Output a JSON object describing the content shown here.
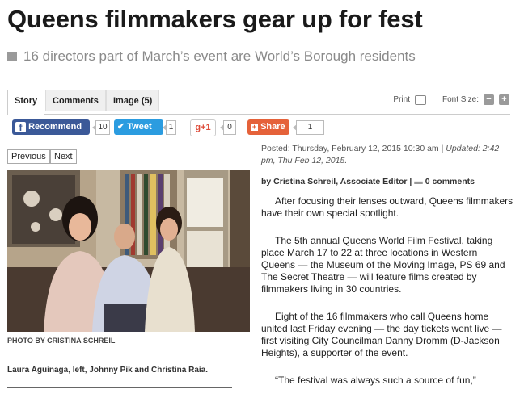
{
  "headline": "Queens filmmakers gear up for fest",
  "subhead": "16 directors part of March’s event are World’s Borough residents",
  "tabs": [
    {
      "label": "Story"
    },
    {
      "label": "Comments"
    },
    {
      "label": "Image (5)"
    }
  ],
  "tools": {
    "print": "Print",
    "font_size": "Font Size:",
    "minus": "−",
    "plus": "+"
  },
  "social": {
    "facebook": {
      "label": "Recommend",
      "count": "10"
    },
    "twitter": {
      "label": "Tweet",
      "count": "1"
    },
    "gplus": {
      "label": "g+1",
      "count": "0"
    },
    "share": {
      "label": "Share",
      "count": "1"
    }
  },
  "gallery": {
    "prev": "Previous",
    "next": "Next",
    "credit": "PHOTO BY CRISTINA SCHREIL",
    "caption": "Laura Aguinaga, left, Johnny Pik and Christina Raia."
  },
  "meta": {
    "posted": "Posted: Thursday, February 12, 2015 10:30 am |",
    "updated": "Updated: 2:42 pm, Thu Feb 12, 2015.",
    "byline": "by Cristina Schreil, Associate Editor |",
    "comments": "0 comments"
  },
  "article": {
    "p1": "After focusing their lenses outward, Queens filmmakers have their own special spotlight.",
    "p2": "The 5th annual Queens World Film Festival, taking place March 17 to 22 at three locations in Western Queens — the Museum of the Moving Image, PS 69 and The Secret Theatre — will feature films created by filmmakers living in 30 countries.",
    "p3": "Eight of the 16 filmmakers who call Queens home united last Friday evening — the day tickets went live — first visiting City Councilman Danny Dromm (D-Jackson Heights), a supporter of the event.",
    "p4": "“The festival was always such a source of fun,”"
  },
  "colors": {
    "facebook": "#3b5998",
    "twitter": "#2b9ce0",
    "share": "#e5623a",
    "gplus_text": "#dd4b39"
  }
}
